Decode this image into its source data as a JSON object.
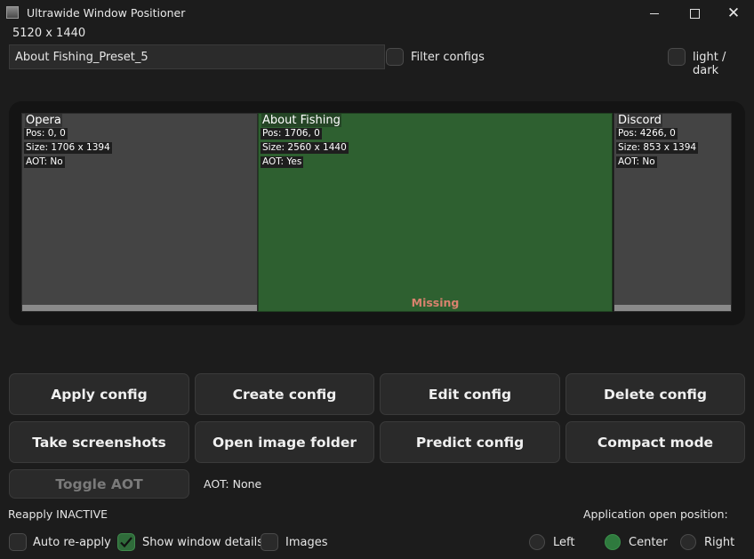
{
  "window": {
    "title": "Ultrawide Window Positioner",
    "icon": "app-icon"
  },
  "resolution": "5120 x 1440",
  "config": {
    "selected": "About Fishing_Preset_5"
  },
  "filter_label": "Filter configs",
  "theme_label": "light / dark",
  "preview": {
    "windows": [
      {
        "name": "Opera",
        "pos": "Pos: 0, 0",
        "size": "Size: 1706 x 1394",
        "aot": "AOT: No"
      },
      {
        "name": "About Fishing",
        "pos": "Pos: 1706, 0",
        "size": "Size: 2560 x 1440",
        "aot": "AOT: Yes",
        "status": "Missing"
      },
      {
        "name": "Discord",
        "pos": "Pos: 4266, 0",
        "size": "Size: 853 x 1394",
        "aot": "AOT: No"
      }
    ]
  },
  "buttons": {
    "apply": "Apply config",
    "create": "Create config",
    "edit": "Edit config",
    "delete": "Delete config",
    "screenshots": "Take screenshots",
    "open_folder": "Open image folder",
    "predict": "Predict config",
    "compact": "Compact mode",
    "toggle_aot": "Toggle AOT"
  },
  "aot_status": "AOT: None",
  "reapply_status": "Reapply INACTIVE",
  "options": {
    "auto_reapply": {
      "label": "Auto re-apply",
      "checked": false
    },
    "show_details": {
      "label": "Show window details",
      "checked": true
    },
    "images": {
      "label": "Images",
      "checked": false
    }
  },
  "open_position": {
    "label": "Application open position:",
    "choices": [
      "Left",
      "Center",
      "Right"
    ],
    "selected": "Center"
  },
  "colors": {
    "accent_green": "#2f7a3e",
    "window_green": "#2e6030",
    "missing": "#d9826e"
  }
}
